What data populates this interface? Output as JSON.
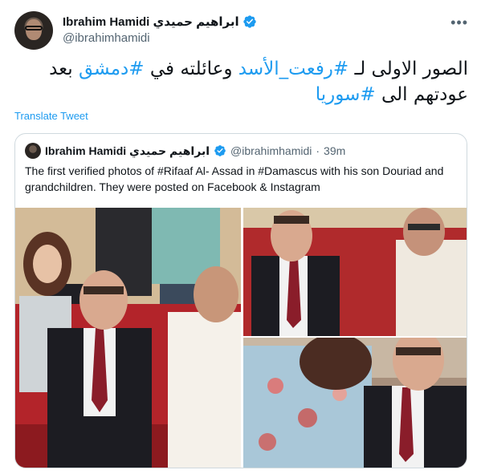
{
  "author": {
    "display_name": "Ibrahim Hamidi ابراهيم حميدي",
    "handle": "@ibrahimhamidi",
    "avatar_icon": "avatar-photo",
    "verified_icon": "verified-badge-icon"
  },
  "more_icon": "more-options-icon",
  "tweet": {
    "text_part1": "الصور الاولى لـ ",
    "hashtag1": "#رفعت_الأسد",
    "text_part2": " وعائلته في ",
    "hashtag2": "#دمشق",
    "text_part3": " بعد عودتهم الى ",
    "hashtag3": "#سوريا",
    "translate_label": "Translate Tweet"
  },
  "quoted_tweet": {
    "display_name": "Ibrahim Hamidi ابراهيم حميدي",
    "handle": "@ibrahimhamidi",
    "separator": "·",
    "time": "39m",
    "text": "The first verified photos of #Rifaaf Al- Assad in #Damascus with his son Douriad and grandchildren. They were posted on Facebook & Instagram",
    "photos": [
      "photo-group-sofa",
      "photo-conversation",
      "photo-with-child"
    ]
  },
  "colors": {
    "link": "#1d9bf0",
    "text": "#0f1419",
    "secondary": "#536471",
    "border": "#cfd9de"
  }
}
